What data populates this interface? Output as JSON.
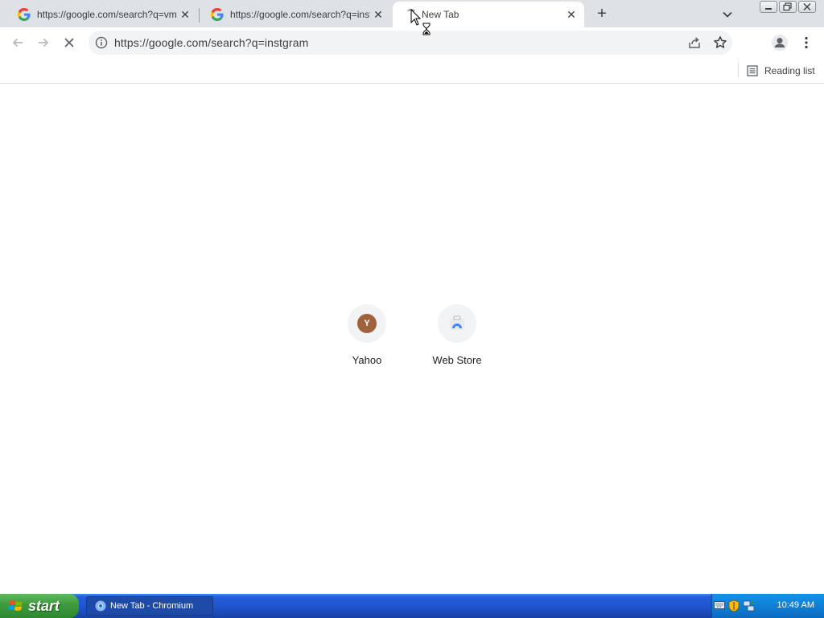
{
  "tabs": [
    {
      "title": "https://google.com/search?q=vmware",
      "close": "✕"
    },
    {
      "title": "https://google.com/search?q=inst",
      "close": "✕"
    },
    {
      "title": "New Tab",
      "close": "✕"
    }
  ],
  "new_tab_symbol": "+",
  "omnibox": {
    "url": "https://google.com/search?q=instgram"
  },
  "bookmarks_bar": {
    "reading_list_label": "Reading list"
  },
  "shortcuts": [
    {
      "title": "Yahoo",
      "badge_letter": "Y"
    },
    {
      "title": "Web Store"
    }
  ],
  "taskbar": {
    "start_label": "start",
    "window_label": "New Tab - Chromium",
    "clock": "10:49 AM"
  },
  "colors": {
    "yahoo_badge": "#a0623c",
    "taskbar": "#245edb",
    "start": "#3c9a3c"
  }
}
